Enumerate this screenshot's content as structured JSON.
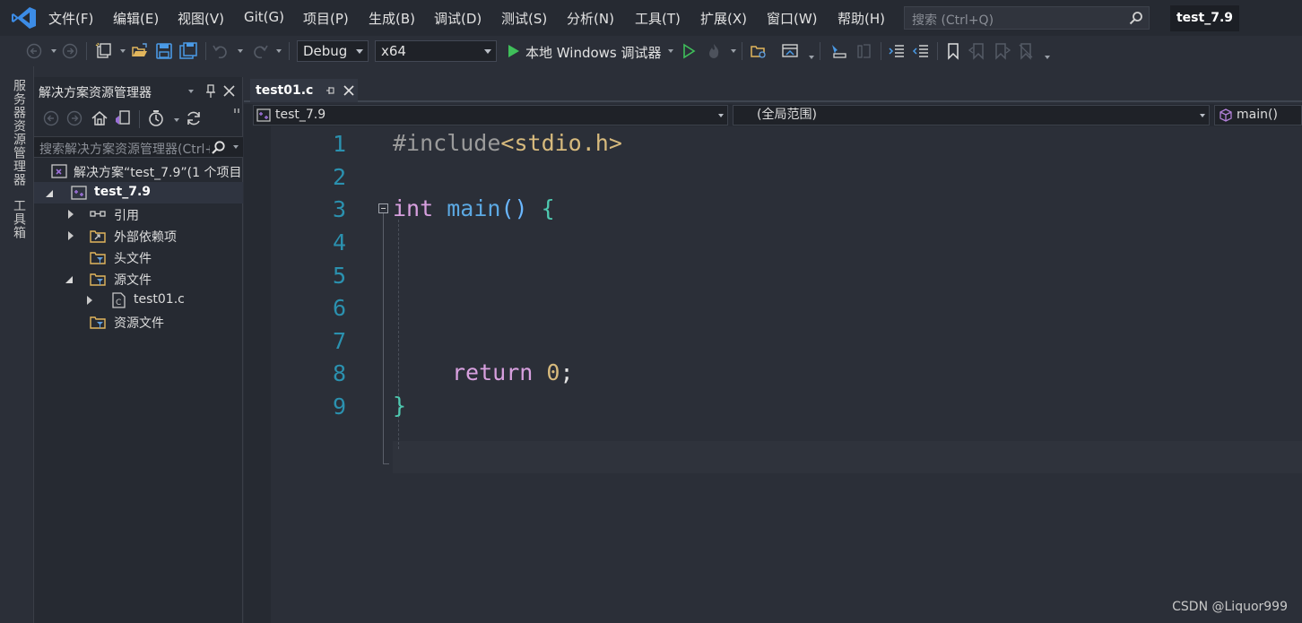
{
  "menu": {
    "items": [
      {
        "label": "文件(F)"
      },
      {
        "label": "编辑(E)"
      },
      {
        "label": "视图(V)"
      },
      {
        "label": "Git(G)"
      },
      {
        "label": "项目(P)"
      },
      {
        "label": "生成(B)"
      },
      {
        "label": "调试(D)"
      },
      {
        "label": "测试(S)"
      },
      {
        "label": "分析(N)"
      },
      {
        "label": "工具(T)"
      },
      {
        "label": "扩展(X)"
      },
      {
        "label": "窗口(W)"
      },
      {
        "label": "帮助(H)"
      }
    ],
    "search_placeholder": "搜索 (Ctrl+Q)",
    "solution_name": "test_7.9"
  },
  "toolbar": {
    "configuration": "Debug",
    "platform": "x64",
    "run_label": "本地 Windows 调试器"
  },
  "side_tabs": {
    "server_explorer": "服务器资源管理器",
    "toolbox": "工具箱"
  },
  "solution_explorer": {
    "title": "解决方案资源管理器",
    "search_placeholder": "搜索解决方案资源管理器(Ctrl+;)",
    "tree": [
      {
        "label": "解决方案“test_7.9”(1 个项目",
        "icon": "solution-icon"
      },
      {
        "label": "test_7.9",
        "icon": "project-icon",
        "bold": true
      },
      {
        "label": "引用",
        "icon": "references-icon"
      },
      {
        "label": "外部依赖项",
        "icon": "external-deps-icon"
      },
      {
        "label": "头文件",
        "icon": "filter-folder-icon"
      },
      {
        "label": "源文件",
        "icon": "filter-folder-icon"
      },
      {
        "label": "test01.c",
        "icon": "c-file-icon"
      },
      {
        "label": "资源文件",
        "icon": "filter-folder-icon"
      }
    ]
  },
  "editor": {
    "tab_label": "test01.c",
    "nav": {
      "project": "test_7.9",
      "scope": "(全局范围)",
      "member": "main()"
    },
    "line_numbers": [
      "1",
      "2",
      "3",
      "4",
      "5",
      "6",
      "7",
      "8",
      "9"
    ],
    "code": {
      "l1_pp": "#include",
      "l1_hdr": "<stdio.h>",
      "l3_kw": "int",
      "l3_fn": "main",
      "l3_paren": "()",
      "l3_brace": "{",
      "l8_kw": "return",
      "l8_num": "0",
      "l8_semi": ";",
      "l9_brace": "}"
    }
  },
  "watermark": "CSDN @Liquor999"
}
